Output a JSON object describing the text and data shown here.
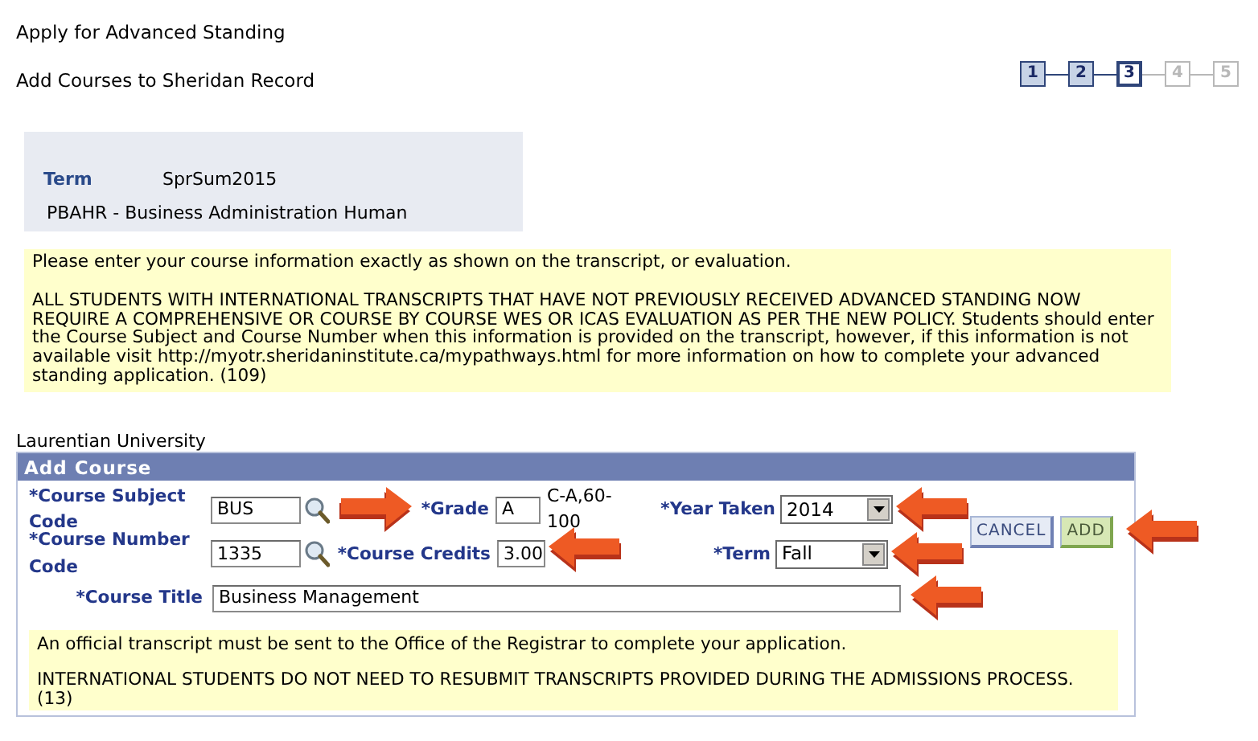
{
  "page": {
    "title": "Apply for Advanced Standing",
    "subtitle": "Add Courses to Sheridan Record"
  },
  "steps": [
    {
      "label": "1",
      "selected": false,
      "disabled": false
    },
    {
      "label": "2",
      "selected": false,
      "disabled": false
    },
    {
      "label": "3",
      "selected": true,
      "disabled": false
    },
    {
      "label": "4",
      "selected": false,
      "disabled": true
    },
    {
      "label": "5",
      "selected": false,
      "disabled": true
    }
  ],
  "term_box": {
    "term_label": "Term",
    "term_value": "SprSum2015",
    "program": "PBAHR - Business Administration Human"
  },
  "instructions": [
    "Please enter your course information exactly as shown on the transcript, or evaluation.",
    "ALL STUDENTS WITH INTERNATIONAL TRANSCRIPTS THAT HAVE NOT PREVIOUSLY RECEIVED ADVANCED STANDING NOW REQUIRE A COMPREHENSIVE OR COURSE BY COURSE WES OR ICAS EVALUATION AS PER THE NEW POLICY.  Students should enter the Course Subject and Course Number when this information is provided on the transcript, however, if this information is not available  visit http://myotr.sheridaninstitute.ca/mypathways.html for more information on how to complete your advanced standing application. (109)"
  ],
  "institution": "Laurentian University",
  "add_course": {
    "title": "Add Course",
    "subject_code": {
      "label": "*Course Subject Code",
      "value": "BUS"
    },
    "grade": {
      "label": "*Grade",
      "value": "A",
      "hint": "C-A,60-100",
      "annotated": true
    },
    "year_taken": {
      "label": "*Year Taken",
      "value": "2014",
      "annotated": true
    },
    "course_number": {
      "label": "*Course Number Code",
      "value": "1335"
    },
    "credits": {
      "label": "*Course Credits",
      "value": "3.00",
      "annotated": true
    },
    "term": {
      "label": "*Term",
      "value": "Fall",
      "annotated": true
    },
    "title_field": {
      "label": "*Course Title",
      "value": "Business Management",
      "annotated": true
    },
    "buttons": [
      {
        "label": "CANCEL",
        "kind": "cancel"
      },
      {
        "label": "ADD",
        "kind": "add",
        "annotated": true
      }
    ],
    "notes": [
      "An official transcript must be sent to the Office of the Registrar to complete your application.",
      "INTERNATIONAL STUDENTS DO NOT NEED TO RESUBMIT TRANSCRIPTS PROVIDED DURING THE ADMISSIONS PROCESS. (13)"
    ]
  }
}
